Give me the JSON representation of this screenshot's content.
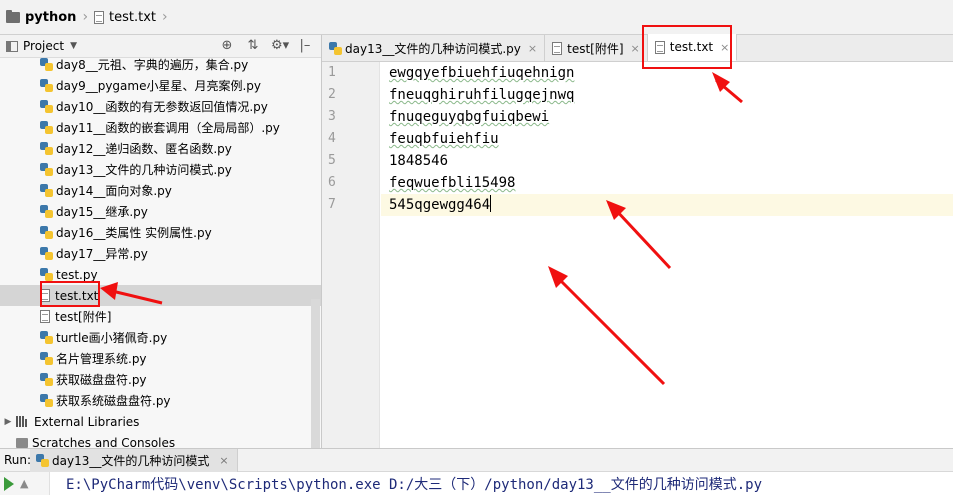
{
  "breadcrumb": {
    "project": "python",
    "file": "test.txt"
  },
  "project_panel": {
    "title": "Project",
    "tools": {
      "locate": "⊕",
      "collapse": "⇅",
      "settings": "⚙▾",
      "hide": "|–"
    },
    "items": [
      {
        "label": "day8__元祖、字典的遍历，集合.py",
        "type": "py"
      },
      {
        "label": "day9__pygame小星星、月亮案例.py",
        "type": "py"
      },
      {
        "label": "day10__函数的有无参数返回值情况.py",
        "type": "py"
      },
      {
        "label": "day11__函数的嵌套调用（全局局部）.py",
        "type": "py"
      },
      {
        "label": "day12__递归函数、匿名函数.py",
        "type": "py"
      },
      {
        "label": "day13__文件的几种访问模式.py",
        "type": "py"
      },
      {
        "label": "day14__面向对象.py",
        "type": "py"
      },
      {
        "label": "day15__继承.py",
        "type": "py"
      },
      {
        "label": "day16__类属性 实例属性.py",
        "type": "py"
      },
      {
        "label": "day17__异常.py",
        "type": "py"
      },
      {
        "label": "test.py",
        "type": "py"
      },
      {
        "label": "test.txt",
        "type": "txt",
        "selected": true
      },
      {
        "label": "test[附件]",
        "type": "txt"
      },
      {
        "label": "turtle画小猪佩奇.py",
        "type": "py"
      },
      {
        "label": "名片管理系统.py",
        "type": "py"
      },
      {
        "label": "获取磁盘盘符.py",
        "type": "py"
      },
      {
        "label": "获取系统磁盘盘符.py",
        "type": "py"
      }
    ],
    "external_libraries": "External Libraries",
    "scratches": "Scratches and Consoles"
  },
  "editor": {
    "tabs": [
      {
        "label": "day13__文件的几种访问模式.py",
        "type": "py",
        "active": false
      },
      {
        "label": "test[附件]",
        "type": "txt",
        "active": false
      },
      {
        "label": "test.txt",
        "type": "txt",
        "active": true
      }
    ],
    "close_glyph": "×",
    "lines": [
      "ewgqyefbiuehfiuqehnign",
      "fneuqghiruhfilugqejnwq",
      "fnuqeguyqbgfuiqbewi",
      "feuqbfuiehfiu",
      "1848546",
      "feqwuefbli15498",
      "545qgewgg464"
    ],
    "line_numbers": [
      "1",
      "2",
      "3",
      "4",
      "5",
      "6",
      "7"
    ],
    "current_line": 7
  },
  "run": {
    "label": "Run:",
    "tab": "day13__文件的几种访问模式",
    "command": "E:\\PyCharm代码\\venv\\Scripts\\python.exe D:/大三（下）/python/day13__文件的几种访问模式.py"
  },
  "colors": {
    "annotation": "#f01010",
    "selected_row": "#d5d5d5",
    "current_line": "#fdf9e3"
  }
}
